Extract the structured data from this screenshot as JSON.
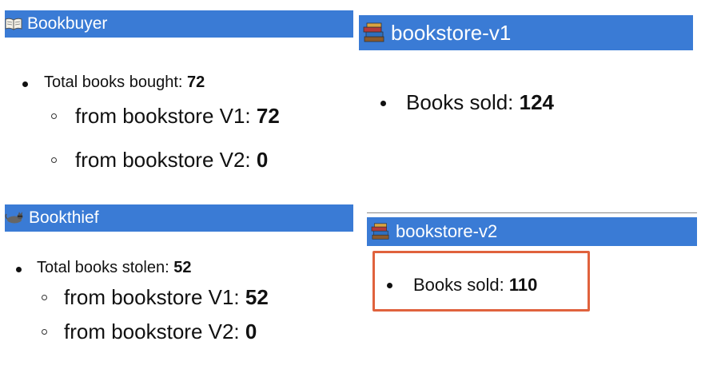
{
  "bookbuyer": {
    "title": "Bookbuyer",
    "icon": "open-book-icon",
    "total_label": "Total books bought: ",
    "total_value": "72",
    "v1_label": "from bookstore V1: ",
    "v1_value": "72",
    "v2_label": "from bookstore V2: ",
    "v2_value": "0"
  },
  "bookthief": {
    "title": "Bookthief",
    "icon": "thief-cat-icon",
    "total_label": "Total books stolen: ",
    "total_value": "52",
    "v1_label": "from bookstore V1: ",
    "v1_value": "52",
    "v2_label": "from bookstore V2: ",
    "v2_value": "0"
  },
  "bookstore_v1": {
    "title": "bookstore-v1",
    "icon": "book-stack-icon",
    "sold_label": "Books sold: ",
    "sold_value": "124"
  },
  "bookstore_v2": {
    "title": "bookstore-v2",
    "icon": "book-stack-icon",
    "sold_label": "Books sold: ",
    "sold_value": "110",
    "highlight_color": "#e0623d"
  },
  "colors": {
    "header_bar": "#3a7bd5",
    "header_text": "#ffffff"
  }
}
